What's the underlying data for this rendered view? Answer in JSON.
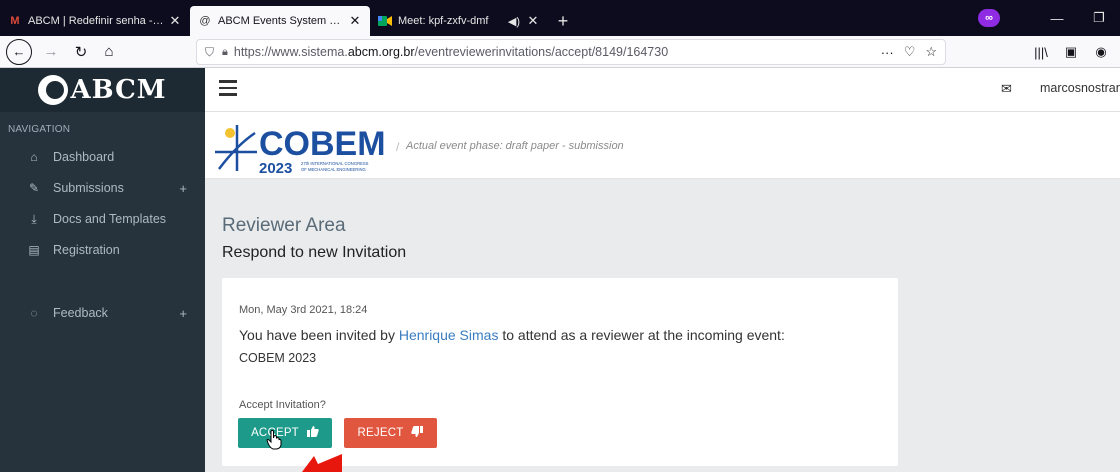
{
  "browser": {
    "tabs": [
      {
        "favicon": "gmail-icon",
        "title": "ABCM | Redefinir senha - marcos"
      },
      {
        "favicon": "abcm-icon",
        "title": "ABCM Events System EventReviewer"
      },
      {
        "favicon": "meet-icon",
        "title": "Meet: kpf-zxfv-dmf"
      }
    ],
    "new_tab": "+",
    "url_host": "https://www.sistema.",
    "url_domain": "abcm.org.br",
    "url_path": "/eventreviewerinvitations/accept/8149/164730",
    "url_actions": "···"
  },
  "app": {
    "logo_text": "ABCM",
    "username": "marcosnostrani"
  },
  "sidebar": {
    "heading": "NAVIGATION",
    "items": [
      {
        "label": "Dashboard",
        "icon": "home-icon"
      },
      {
        "label": "Submissions",
        "icon": "pencil-icon",
        "expand": "+"
      },
      {
        "label": "Docs and Templates",
        "icon": "download-icon"
      },
      {
        "label": "Registration",
        "icon": "document-icon"
      },
      {
        "label": "Feedback",
        "icon": "chat-icon",
        "expand": "+"
      }
    ]
  },
  "event": {
    "name": "COBEM",
    "year": "2023",
    "tagline_1": "27th INTERNATIONAL CONGRESS",
    "tagline_2": "OF MECHANICAL ENGINEERING",
    "phase_sep": "/",
    "phase": "Actual event phase: draft paper - submission"
  },
  "main": {
    "title": "Reviewer Area",
    "subtitle": "Respond to new Invitation",
    "date": "Mon, May 3rd 2021, 18:24",
    "msg_before": "You have been invited by ",
    "inviter": "Henrique Simas",
    "msg_after": " to attend as a reviewer at the incoming event:",
    "event_name": "COBEM 2023",
    "question": "Accept Invitation?",
    "accept_label": "ACCEPT",
    "reject_label": "REJECT"
  },
  "colors": {
    "sidebar_bg": "#26333d",
    "accept": "#1e9a8a",
    "reject": "#e0563f",
    "link": "#3a7dc0",
    "cobem_blue": "#1c4fa0",
    "cobem_yellow": "#f2c230"
  }
}
